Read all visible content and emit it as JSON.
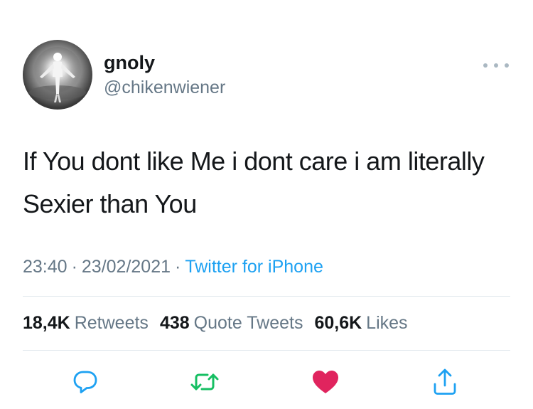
{
  "user": {
    "display_name": "gnoly",
    "handle": "@chikenwiener"
  },
  "tweet": {
    "text": "If You dont like Me i dont care i am literally Sexier than You",
    "time": "23:40",
    "date": "23/02/2021",
    "separator": "·",
    "source": "Twitter for iPhone"
  },
  "stats": {
    "retweets_count": "18,4K",
    "retweets_label": "Retweets",
    "quotes_count": "438",
    "quotes_label": "Quote Tweets",
    "likes_count": "60,6K",
    "likes_label": "Likes"
  },
  "actions": {
    "reply_icon": "reply-icon",
    "retweet_icon": "retweet-icon",
    "like_icon": "heart-icon",
    "share_icon": "share-icon",
    "liked": true
  },
  "colors": {
    "link": "#1da1f2",
    "secondary_text": "#657786",
    "retweet": "#17bf63",
    "like": "#e0245e",
    "icon": "#1da1f2"
  }
}
